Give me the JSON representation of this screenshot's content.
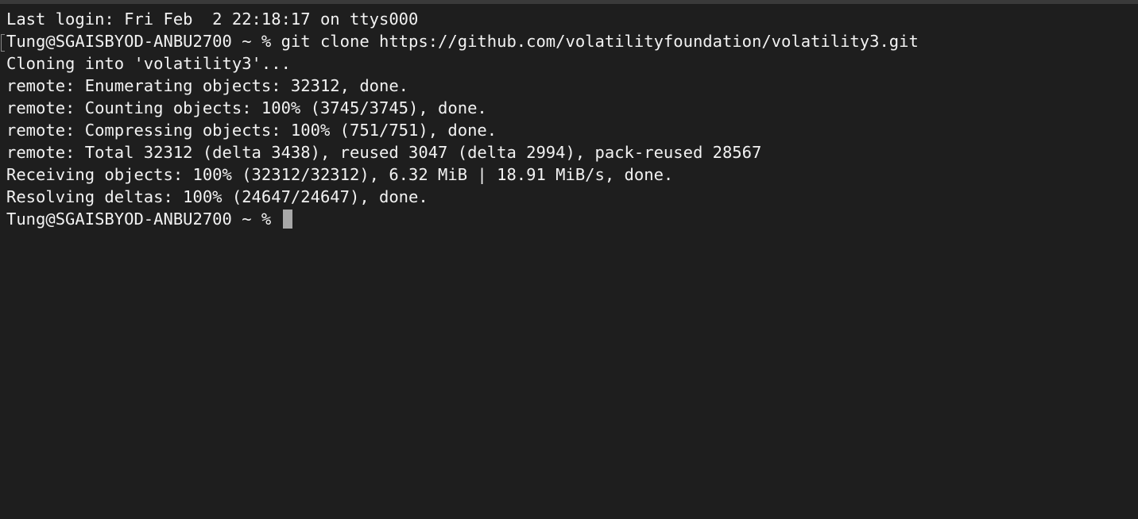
{
  "terminal": {
    "lines": [
      "Last login: Fri Feb  2 22:18:17 on ttys000",
      "Tung@SGAISBYOD-ANBU2700 ~ % git clone https://github.com/volatilityfoundation/volatility3.git",
      "Cloning into 'volatility3'...",
      "remote: Enumerating objects: 32312, done.",
      "remote: Counting objects: 100% (3745/3745), done.",
      "remote: Compressing objects: 100% (751/751), done.",
      "remote: Total 32312 (delta 3438), reused 3047 (delta 2994), pack-reused 28567",
      "Receiving objects: 100% (32312/32312), 6.32 MiB | 18.91 MiB/s, done.",
      "Resolving deltas: 100% (24647/24647), done."
    ],
    "prompt": "Tung@SGAISBYOD-ANBU2700 ~ % "
  }
}
